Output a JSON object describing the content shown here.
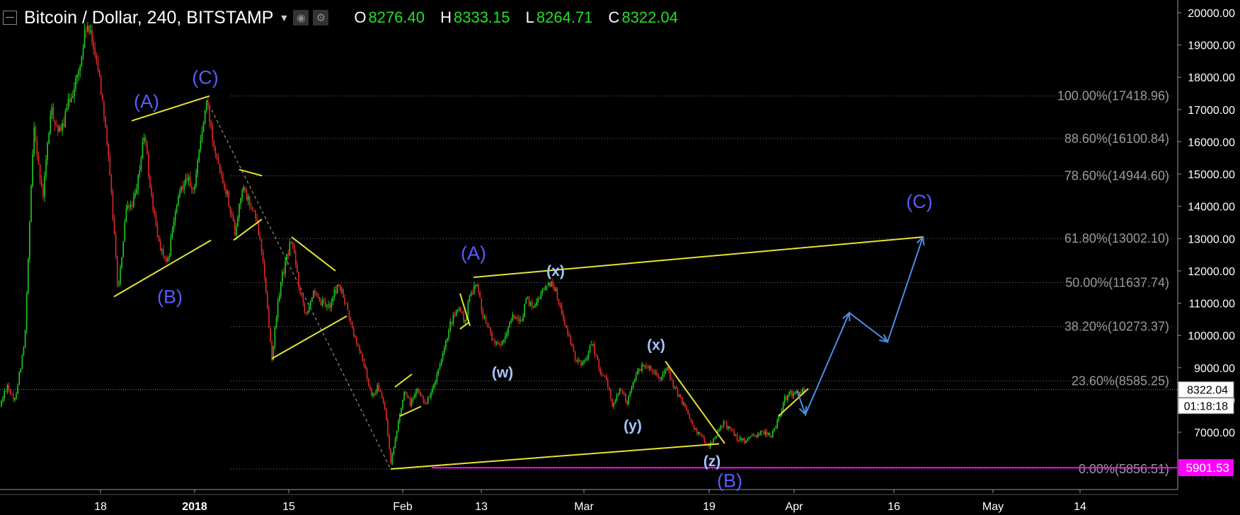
{
  "header": {
    "symbol": "Bitcoin / Dollar, 240, BITSTAMP",
    "open_label": "O",
    "open": "8276.40",
    "high_label": "H",
    "high": "8333.15",
    "low_label": "L",
    "low": "8264.71",
    "close_label": "C",
    "close": "8322.04",
    "up_color": "#22e022"
  },
  "chart_data": {
    "type": "candlestick",
    "price_scale": {
      "ticks": [
        "20000.00",
        "19000.00",
        "18000.00",
        "17000.00",
        "16000.00",
        "15000.00",
        "14000.00",
        "13000.00",
        "12000.00",
        "11000.00",
        "10000.00",
        "9000.00",
        "8000.00",
        "7000.00"
      ],
      "ylim": [
        5300,
        20250
      ]
    },
    "time_axis": {
      "labels": [
        "18",
        "2018",
        "15",
        "Feb",
        "13",
        "Mar",
        "19",
        "Apr",
        "16",
        "May",
        "14"
      ]
    },
    "fibonacci_levels": [
      {
        "label": "100.00%(17418.96)",
        "value": 17418.96
      },
      {
        "label": "88.60%(16100.84)",
        "value": 16100.84
      },
      {
        "label": "78.60%(14944.60)",
        "value": 14944.6
      },
      {
        "label": "61.80%(13002.10)",
        "value": 13002.1
      },
      {
        "label": "50.00%(11637.74)",
        "value": 11637.74
      },
      {
        "label": "38.20%(10273.37)",
        "value": 10273.37
      },
      {
        "label": "23.60%(8585.25)",
        "value": 8585.25
      },
      {
        "label": "0.00%(5856.51)",
        "value": 5856.51
      }
    ],
    "current_price": {
      "label": "8322.04",
      "countdown": "01:18:18",
      "value": 8322.04
    },
    "support_line": {
      "label": "5901.53",
      "value": 5901.53,
      "color": "#ff00ff"
    },
    "path_points": [
      [
        0,
        7800
      ],
      [
        10,
        8500
      ],
      [
        20,
        7900
      ],
      [
        35,
        9800
      ],
      [
        48,
        16600
      ],
      [
        60,
        14200
      ],
      [
        72,
        17000
      ],
      [
        85,
        16200
      ],
      [
        98,
        17300
      ],
      [
        112,
        18200
      ],
      [
        122,
        19600
      ],
      [
        135,
        18800
      ],
      [
        148,
        16800
      ],
      [
        160,
        13600
      ],
      [
        167,
        11300
      ],
      [
        178,
        13800
      ],
      [
        192,
        14300
      ],
      [
        204,
        16300
      ],
      [
        212,
        14600
      ],
      [
        222,
        13100
      ],
      [
        236,
        12100
      ],
      [
        246,
        13600
      ],
      [
        256,
        14600
      ],
      [
        264,
        15000
      ],
      [
        272,
        14300
      ],
      [
        283,
        16000
      ],
      [
        292,
        17200
      ],
      [
        302,
        16000
      ],
      [
        312,
        15100
      ],
      [
        322,
        14300
      ],
      [
        332,
        13200
      ],
      [
        342,
        14600
      ],
      [
        352,
        14100
      ],
      [
        362,
        13600
      ],
      [
        372,
        12300
      ],
      [
        384,
        9300
      ],
      [
        396,
        11600
      ],
      [
        412,
        13000
      ],
      [
        422,
        11600
      ],
      [
        432,
        10700
      ],
      [
        442,
        11300
      ],
      [
        452,
        11000
      ],
      [
        465,
        10900
      ],
      [
        478,
        11600
      ],
      [
        488,
        11000
      ],
      [
        500,
        10000
      ],
      [
        512,
        9300
      ],
      [
        524,
        8200
      ],
      [
        535,
        8400
      ],
      [
        545,
        7600
      ],
      [
        552,
        6000
      ],
      [
        560,
        6900
      ],
      [
        570,
        8200
      ],
      [
        580,
        7900
      ],
      [
        590,
        8300
      ],
      [
        602,
        7900
      ],
      [
        614,
        8500
      ],
      [
        624,
        9200
      ],
      [
        636,
        10300
      ],
      [
        648,
        10900
      ],
      [
        656,
        10400
      ],
      [
        664,
        11200
      ],
      [
        672,
        11700
      ],
      [
        682,
        10700
      ],
      [
        692,
        10100
      ],
      [
        704,
        9600
      ],
      [
        714,
        9900
      ],
      [
        724,
        10700
      ],
      [
        734,
        10300
      ],
      [
        744,
        11100
      ],
      [
        754,
        10900
      ],
      [
        764,
        11300
      ],
      [
        774,
        11600
      ],
      [
        782,
        11600
      ],
      [
        790,
        11000
      ],
      [
        800,
        10200
      ],
      [
        812,
        9300
      ],
      [
        824,
        9100
      ],
      [
        836,
        9800
      ],
      [
        848,
        8900
      ],
      [
        858,
        8500
      ],
      [
        866,
        7800
      ],
      [
        876,
        8400
      ],
      [
        886,
        7900
      ],
      [
        896,
        8700
      ],
      [
        906,
        9000
      ],
      [
        914,
        9100
      ],
      [
        924,
        8900
      ],
      [
        934,
        8700
      ],
      [
        942,
        9000
      ],
      [
        952,
        8400
      ],
      [
        962,
        8000
      ],
      [
        972,
        7600
      ],
      [
        982,
        7100
      ],
      [
        992,
        6800
      ],
      [
        1002,
        6600
      ],
      [
        1012,
        6900
      ],
      [
        1022,
        7300
      ],
      [
        1032,
        7100
      ],
      [
        1042,
        6800
      ],
      [
        1054,
        6700
      ],
      [
        1066,
        6900
      ],
      [
        1078,
        7000
      ],
      [
        1090,
        6900
      ],
      [
        1100,
        7400
      ],
      [
        1108,
        8000
      ],
      [
        1118,
        8200
      ],
      [
        1128,
        8200
      ],
      [
        1138,
        8300
      ]
    ],
    "wave_labels": [
      {
        "text": "(A)",
        "x": 207,
        "price": 17050,
        "style": "major"
      },
      {
        "text": "(B)",
        "x": 240,
        "price": 11000,
        "style": "major"
      },
      {
        "text": "(C)",
        "x": 290,
        "price": 17800,
        "style": "major"
      },
      {
        "text": "(A)",
        "x": 669,
        "price": 12350,
        "style": "major"
      },
      {
        "text": "(x)",
        "x": 785,
        "price": 11850,
        "style": "minor"
      },
      {
        "text": "(w)",
        "x": 710,
        "price": 8700,
        "style": "minor"
      },
      {
        "text": "(x)",
        "x": 927,
        "price": 9550,
        "style": "minor"
      },
      {
        "text": "(y)",
        "x": 894,
        "price": 7050,
        "style": "minor"
      },
      {
        "text": "(z)",
        "x": 1006,
        "price": 5950,
        "style": "minor"
      },
      {
        "text": "(B)",
        "x": 1031,
        "price": 5300,
        "style": "major"
      },
      {
        "text": "(C)",
        "x": 1299,
        "price": 13950,
        "style": "major"
      }
    ],
    "trend_lines": [
      [
        [
          186,
          16650
        ],
        [
          296,
          17420
        ]
      ],
      [
        [
          161,
          11200
        ],
        [
          298,
          12950
        ]
      ],
      [
        [
          338,
          15140
        ],
        [
          370,
          14950
        ]
      ],
      [
        [
          330,
          12950
        ],
        [
          370,
          13600
        ]
      ],
      [
        [
          412,
          13050
        ],
        [
          474,
          12000
        ]
      ],
      [
        [
          384,
          9280
        ],
        [
          490,
          10600
        ]
      ],
      [
        [
          558,
          8400
        ],
        [
          582,
          8800
        ]
      ],
      [
        [
          565,
          7500
        ],
        [
          595,
          7800
        ]
      ],
      [
        [
          650,
          11300
        ],
        [
          664,
          10300
        ]
      ],
      [
        [
          650,
          10200
        ],
        [
          662,
          10400
        ]
      ],
      [
        [
          669,
          11800
        ],
        [
          1304,
          13050
        ]
      ],
      [
        [
          552,
          5860
        ],
        [
          1016,
          6640
        ]
      ],
      [
        [
          940,
          9200
        ],
        [
          1024,
          6650
        ]
      ],
      [
        [
          1100,
          7500
        ],
        [
          1142,
          8350
        ]
      ]
    ],
    "forecast_path": [
      [
        1126,
        8300
      ],
      [
        1138,
        7550
      ],
      [
        1200,
        10700
      ],
      [
        1254,
        9800
      ],
      [
        1304,
        13050
      ]
    ],
    "drop_line": [
      [
        292,
        17300
      ],
      [
        552,
        5860
      ]
    ],
    "colors": {
      "up": "#1fd01f",
      "down": "#e02a2a",
      "annotation": "#e4e436",
      "forecast": "#4a90e2",
      "wave_major": "#5a5aff",
      "wave_minor": "#a8c4ff",
      "fib_text": "#9a9a9a"
    }
  }
}
